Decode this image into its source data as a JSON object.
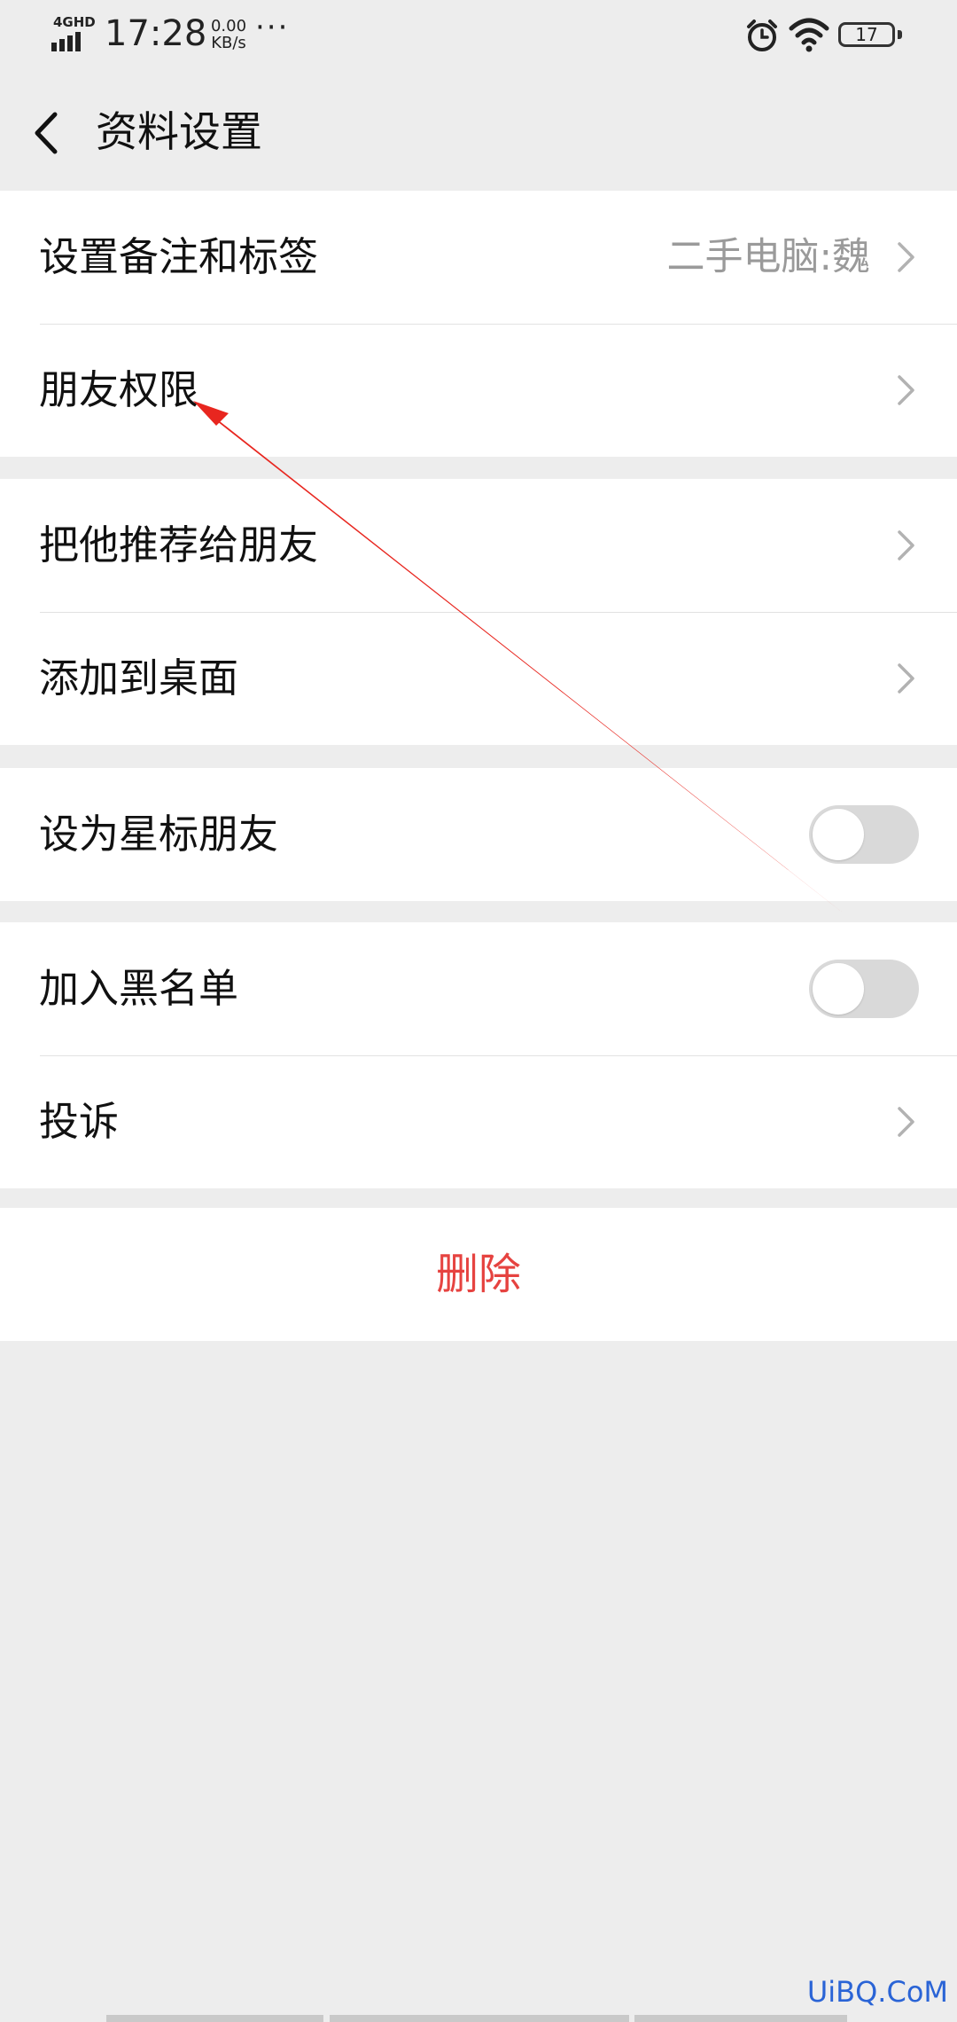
{
  "status_bar": {
    "network": "4GHD",
    "time": "17:28",
    "speed_value": "0.00",
    "speed_unit": "KB/s",
    "dots": "···",
    "battery": "17"
  },
  "header": {
    "title": "资料设置"
  },
  "groups": {
    "group1": {
      "remark": {
        "label": "设置备注和标签",
        "value": "二手电脑:魏"
      },
      "permission": {
        "label": "朋友权限"
      }
    },
    "group2": {
      "recommend": {
        "label": "把他推荐给朋友"
      },
      "desktop": {
        "label": "添加到桌面"
      }
    },
    "group3": {
      "star": {
        "label": "设为星标朋友",
        "enabled": false
      }
    },
    "group4": {
      "blacklist": {
        "label": "加入黑名单",
        "enabled": false
      },
      "complain": {
        "label": "投诉"
      }
    }
  },
  "delete_label": "删除",
  "watermark": "UiBQ.CoM",
  "colors": {
    "background": "#ededed",
    "delete_red": "#e64340",
    "annotation_arrow": "#e8261f",
    "watermark_blue": "#2a64d6"
  }
}
